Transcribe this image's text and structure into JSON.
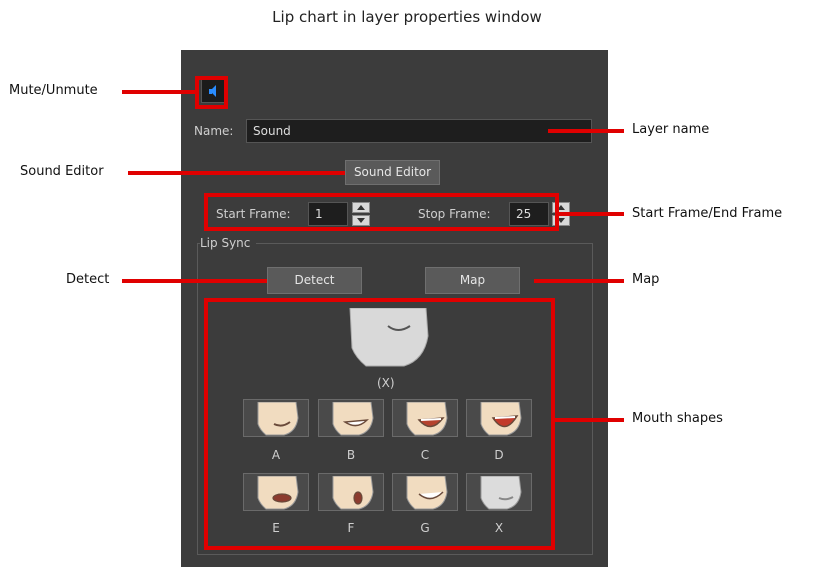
{
  "title": "Lip chart in layer properties window",
  "callouts": {
    "mute": "Mute/Unmute",
    "sound_editor": "Sound Editor",
    "detect": "Detect",
    "layer_name": "Layer name",
    "frames": "Start Frame/End Frame",
    "map": "Map",
    "mouth_shapes": "Mouth shapes"
  },
  "panel": {
    "name_label": "Name:",
    "name_value": "Sound",
    "sound_editor_button": "Sound Editor",
    "start_frame_label": "Start Frame:",
    "start_frame_value": "1",
    "stop_frame_label": "Stop Frame:",
    "stop_frame_value": "25",
    "lip_sync_label": "Lip Sync",
    "detect_button": "Detect",
    "map_button": "Map",
    "preview_label": "(X)",
    "mouths": [
      "A",
      "B",
      "C",
      "D",
      "E",
      "F",
      "G",
      "X"
    ]
  },
  "colors": {
    "annotation_red": "#e00000",
    "panel_bg": "#3c3c3c",
    "speaker_blue": "#2a8cff",
    "skin": "#f1dcc0"
  },
  "icons": {
    "mute": "speaker-icon"
  }
}
